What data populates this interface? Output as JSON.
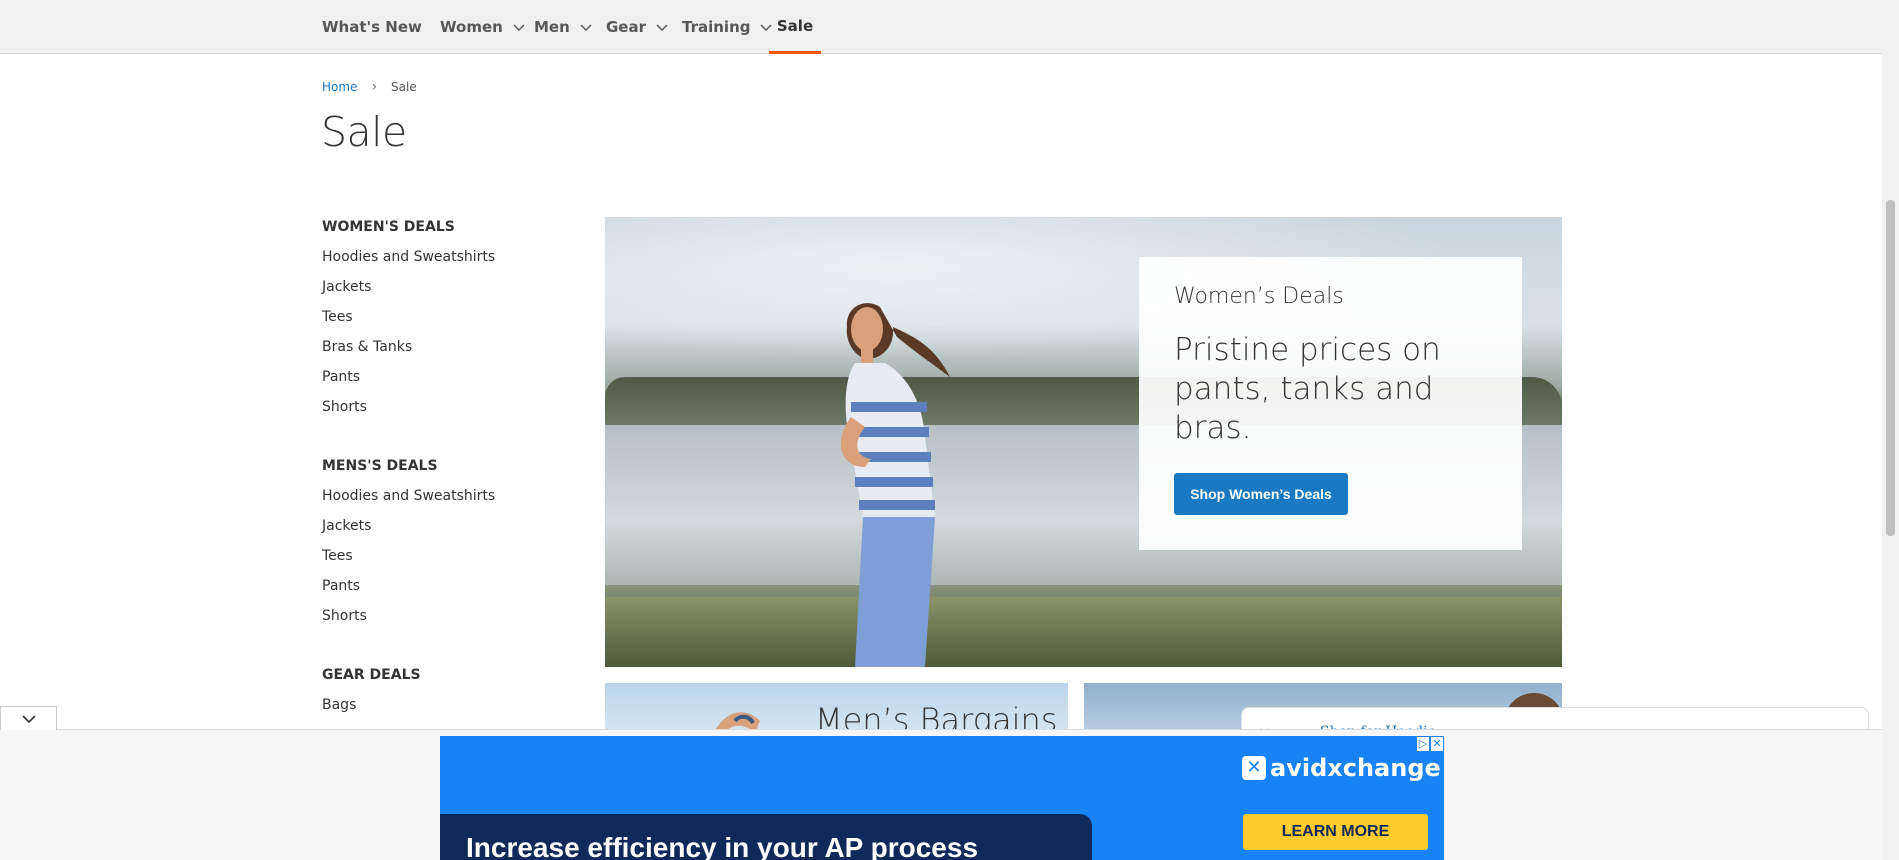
{
  "nav": {
    "items": [
      {
        "label": "What's New"
      },
      {
        "label": "Women"
      },
      {
        "label": "Men"
      },
      {
        "label": "Gear"
      },
      {
        "label": "Training"
      },
      {
        "label": "Sale"
      }
    ],
    "active": "Sale",
    "accent": "#ff5501"
  },
  "breadcrumb": {
    "home": "Home",
    "current": "Sale"
  },
  "page_title": "Sale",
  "sidebar": {
    "groups": [
      {
        "heading": "WOMEN'S DEALS",
        "links": [
          "Hoodies and Sweatshirts",
          "Jackets",
          "Tees",
          "Bras & Tanks",
          "Pants",
          "Shorts"
        ]
      },
      {
        "heading": "MENS'S DEALS",
        "links": [
          "Hoodies and Sweatshirts",
          "Jackets",
          "Tees",
          "Pants",
          "Shorts"
        ]
      },
      {
        "heading": "GEAR DEALS",
        "links": [
          "Bags"
        ]
      }
    ]
  },
  "hero": {
    "kicker": "Women’s Deals",
    "headline": "Pristine prices on pants, tanks and bras.",
    "button": "Shop Women’s Deals",
    "button_color": "#1979c3"
  },
  "tiles": {
    "mens_title": "Men’s Bargains",
    "chat_label": "Shop for Hoodie"
  },
  "ad": {
    "brand": "avidxchange",
    "cta": "LEARN MORE",
    "headline": "Increase efficiency in your AP process",
    "bg_color": "#1783f6",
    "cta_color": "#ffcb2f"
  }
}
